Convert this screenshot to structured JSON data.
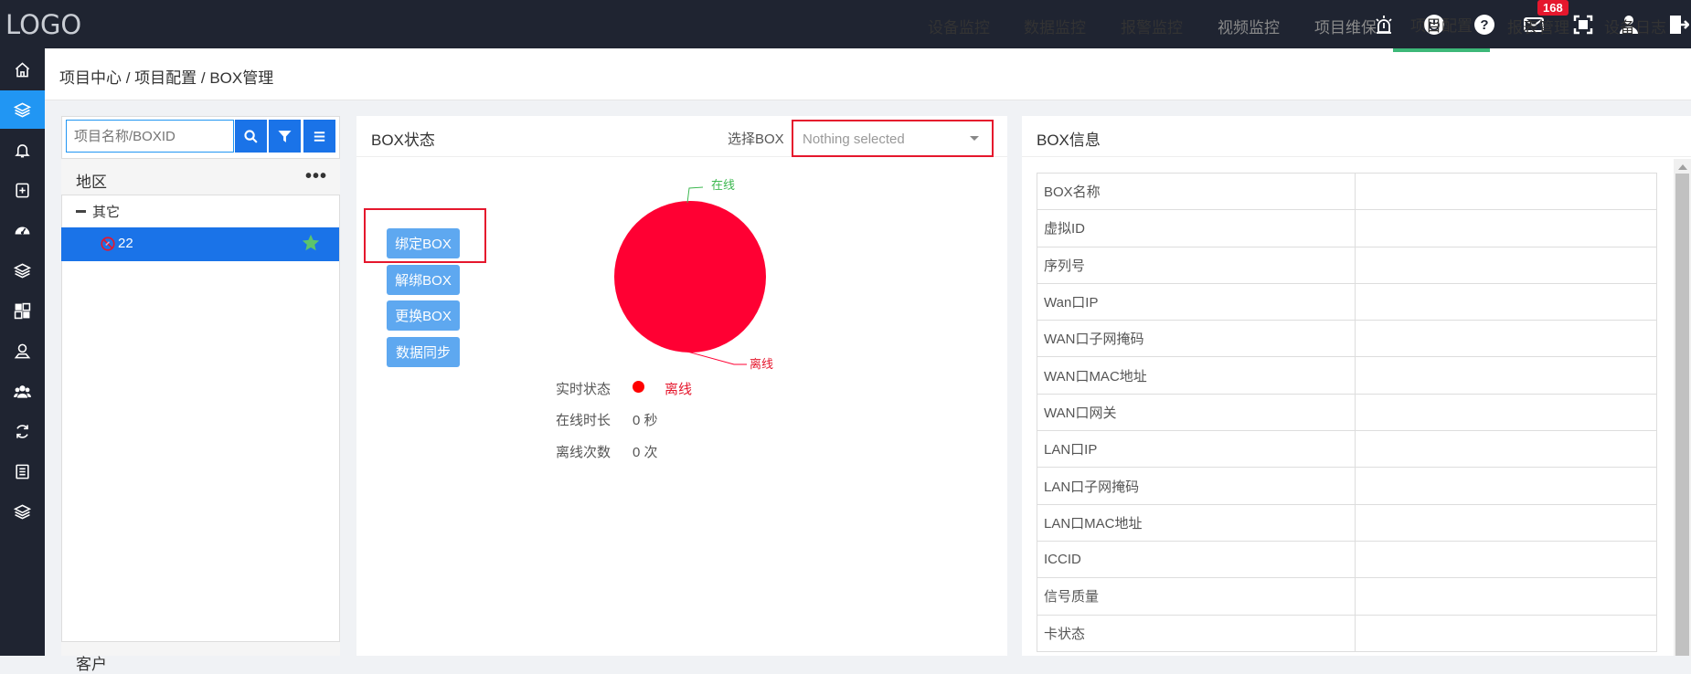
{
  "app": {
    "logo": "LOGO",
    "notification_count": "168"
  },
  "topbar": {
    "icons": [
      "alarm-light-icon",
      "power-icon",
      "help-icon",
      "mail-icon",
      "fullscreen-icon",
      "user-icon",
      "logout-icon"
    ]
  },
  "sidebar": {
    "icons": [
      "home-icon",
      "layers-icon",
      "bell-icon",
      "plus-square-icon",
      "dashboard-icon",
      "layers-icon",
      "grid-icon",
      "user-pin-icon",
      "users-icon",
      "refresh-icon",
      "list-icon",
      "layers-icon"
    ],
    "active_index": 1
  },
  "header": {
    "breadcrumb": "项目中心 / 项目配置 / BOX管理",
    "nav": [
      {
        "label": "设备监控",
        "state": "normal"
      },
      {
        "label": "数据监控",
        "state": "normal"
      },
      {
        "label": "报警监控",
        "state": "normal"
      },
      {
        "label": "视频监控",
        "state": "muted"
      },
      {
        "label": "项目维保",
        "state": "muted"
      },
      {
        "label": "项目配置",
        "state": "active"
      },
      {
        "label": "报表管理",
        "state": "normal"
      },
      {
        "label": "设备日志",
        "state": "normal"
      }
    ]
  },
  "left": {
    "search_placeholder": "项目名称/BOXID",
    "region_title": "地区",
    "region_more": "•••",
    "tree_root": "其它",
    "tree_selected": "22",
    "bottom_section": "客户"
  },
  "middle": {
    "title": "BOX状态",
    "select_label": "选择BOX",
    "select_placeholder": "Nothing selected",
    "buttons": [
      "绑定BOX",
      "解绑BOX",
      "更换BOX",
      "数据同步"
    ],
    "legend_online": "在线",
    "legend_offline": "离线",
    "stats": {
      "realtime_label": "实时状态",
      "realtime_value": "离线",
      "online_duration_label": "在线时长",
      "online_duration_value": "0 秒",
      "offline_count_label": "离线次数",
      "offline_count_value": "0 次"
    }
  },
  "chart_data": {
    "type": "pie",
    "categories": [
      "在线",
      "离线"
    ],
    "values": [
      0,
      1
    ],
    "colors": [
      "#3db850",
      "#ff0033"
    ],
    "title": ""
  },
  "right": {
    "title": "BOX信息",
    "rows": [
      "BOX名称",
      "虚拟ID",
      "序列号",
      "Wan口IP",
      "WAN口子网掩码",
      "WAN口MAC地址",
      "WAN口网关",
      "LAN口IP",
      "LAN口子网掩码",
      "LAN口MAC地址",
      "ICCID",
      "信号质量",
      "卡状态"
    ]
  },
  "colors": {
    "accent": "#1a73e8",
    "highlight": "#e5172d",
    "active_tab": "#3db878",
    "topbar": "#1f2431"
  }
}
